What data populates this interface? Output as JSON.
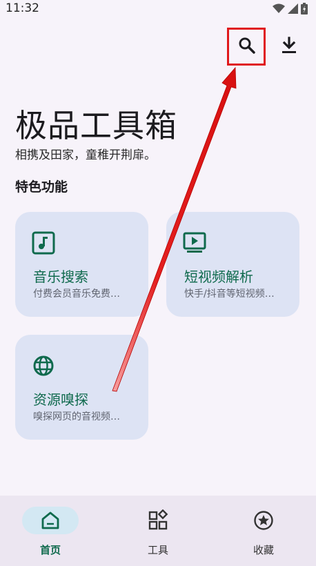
{
  "status_bar": {
    "time": "11:32"
  },
  "toolbar": {
    "search_icon": "search-icon",
    "download_icon": "download-icon"
  },
  "header": {
    "title": "极品工具箱",
    "subtitle": "相携及田家，童稚开荆扉。"
  },
  "section": {
    "title": "特色功能"
  },
  "cards": [
    {
      "title": "音乐搜索",
      "description": "付费会员音乐免费…",
      "icon": "music-note-icon"
    },
    {
      "title": "短视频解析",
      "description": "快手/抖音等短视频…",
      "icon": "video-play-icon"
    },
    {
      "title": "资源嗅探",
      "description": "嗅探网页的音视频…",
      "icon": "globe-icon"
    }
  ],
  "bottom_nav": {
    "items": [
      {
        "label": "首页",
        "icon": "home-icon",
        "selected": true
      },
      {
        "label": "工具",
        "icon": "apps-icon",
        "selected": false
      },
      {
        "label": "收藏",
        "icon": "star-icon",
        "selected": false
      }
    ]
  },
  "colors": {
    "accent": "#0f6a4d",
    "card_background": "#dde3f4",
    "annotation_red": "#e0181b",
    "background": "#f7f3fa"
  }
}
